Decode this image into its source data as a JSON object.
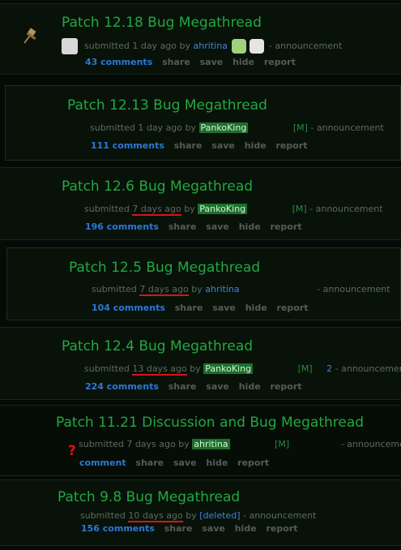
{
  "posts": [
    {
      "title": "Patch 12.18 Bug Megathread",
      "submitted": "submitted",
      "time": "1 day ago",
      "by": "by",
      "author": "ahritina",
      "flag": "- announcement",
      "comments": "43 comments",
      "share": "share",
      "save": "save",
      "hide": "hide",
      "report": "report"
    },
    {
      "title": "Patch 12.13 Bug Megathread",
      "submitted": "submitted",
      "time": "1 day ago",
      "by": "by",
      "author": "PankoKing",
      "mod": "[M]",
      "flag": "- announcement",
      "comments": "111 comments",
      "share": "share",
      "save": "save",
      "hide": "hide",
      "report": "report"
    },
    {
      "title": "Patch 12.6 Bug Megathread",
      "submitted": "submitted",
      "time": "7 days ago",
      "by": "by",
      "author": "PankoKing",
      "mod": "[M]",
      "flag": "- announcement",
      "comments": "196 comments",
      "share": "share",
      "save": "save",
      "hide": "hide",
      "report": "report"
    },
    {
      "title": "Patch 12.5 Bug Megathread",
      "submitted": "submitted",
      "time": "7 days ago",
      "by": "by",
      "author": "ahritina",
      "flag": "- announcement",
      "comments": "104 comments",
      "share": "share",
      "save": "save",
      "hide": "hide",
      "report": "report"
    },
    {
      "title": "Patch 12.4 Bug Megathread",
      "submitted": "submitted",
      "time": "13 days ago",
      "by": "by",
      "author": "PankoKing",
      "mod": "[M]",
      "extra": "2",
      "flag": "- announcement",
      "comments": "224 comments",
      "share": "share",
      "save": "save",
      "hide": "hide",
      "report": "report"
    },
    {
      "title": "Patch 11.21 Discussion and Bug Megathread",
      "submitted": "submitted",
      "time": "7 days ago",
      "by": "by",
      "author": "ahritina",
      "mod": "[M]",
      "flag": "- announceme",
      "comments": "comment",
      "share": "share",
      "save": "save",
      "hide": "hide",
      "report": "report",
      "marker": "?"
    },
    {
      "title": "Patch 9.8 Bug Megathread",
      "submitted": "submitted",
      "time": "10 days ago",
      "by": "by",
      "author": "[deleted]",
      "flag": "- announcement",
      "comments": "156 comments",
      "share": "share",
      "save": "save",
      "hide": "hide",
      "report": "report"
    }
  ]
}
